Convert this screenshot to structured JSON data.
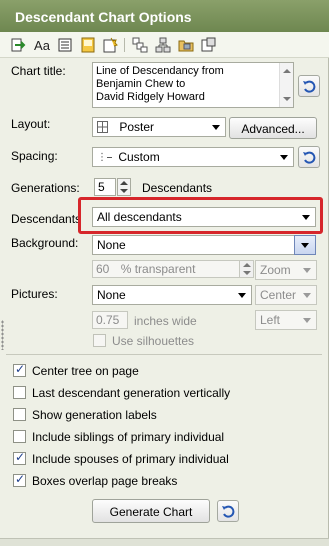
{
  "panel_title": "Descendant Chart Options",
  "toolbar": {
    "font_button": "Aa"
  },
  "chart_title": {
    "label": "Chart title:",
    "lines": [
      "Line of Descendancy from",
      "Benjamin Chew to",
      "David Ridgely Howard"
    ]
  },
  "layout": {
    "label": "Layout:",
    "value": "Poster",
    "advanced_button": "Advanced..."
  },
  "spacing": {
    "label": "Spacing:",
    "value": "Custom"
  },
  "generations": {
    "label": "Generations:",
    "value": "5",
    "suffix": "Descendants"
  },
  "descendants": {
    "label": "Descendants",
    "value": "All descendants"
  },
  "background": {
    "label": "Background:",
    "value": "None",
    "transparency_value": "60",
    "transparency_suffix": "% transparent",
    "zoom_value": "Zoom"
  },
  "pictures": {
    "label": "Pictures:",
    "value": "None",
    "alignment": "Center",
    "width_value": "0.75",
    "width_suffix": "inches wide",
    "position": "Left",
    "silhouettes_label": "Use silhouettes"
  },
  "options": [
    {
      "label": "Center tree on page",
      "checked": true
    },
    {
      "label": "Last descendant generation vertically",
      "checked": false
    },
    {
      "label": "Show generation labels",
      "checked": false
    },
    {
      "label": "Include siblings of primary individual",
      "checked": false
    },
    {
      "label": "Include spouses of primary individual",
      "checked": true
    },
    {
      "label": "Boxes overlap page breaks",
      "checked": true
    }
  ],
  "generate_button": "Generate Chart",
  "colors": {
    "title_bar": "#7a915c",
    "highlight": "#d6262b",
    "panel_bg": "#eef0e6"
  }
}
